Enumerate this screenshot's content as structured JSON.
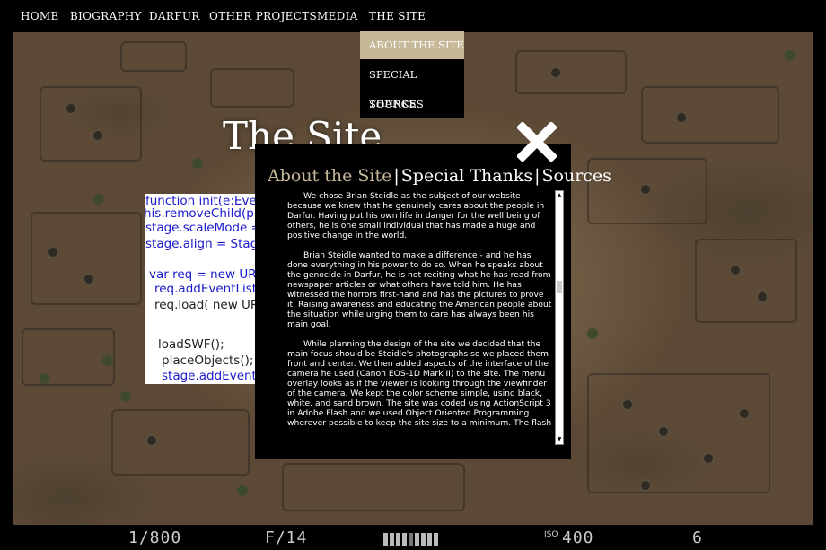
{
  "nav": {
    "items": [
      "HOME",
      "BIOGRAPHY",
      "DARFUR",
      "OTHER PROJECTS",
      "MEDIA",
      "THE SITE"
    ]
  },
  "dropdown": {
    "items": [
      "ABOUT THE SITE",
      "SPECIAL THANKS",
      "SOURCES"
    ],
    "active": "ABOUT THE SITE"
  },
  "page": {
    "title": "The Site",
    "tabs": {
      "about": "About the Site",
      "thanks": "Special Thanks",
      "sources": "Sources",
      "separator": "|"
    },
    "paragraphs": [
      "We chose Brian Steidle as the subject of our website because we knew that he genuinely cares about the people in Darfur. Having put his own life in danger for the well being of others, he is one small individual that has made a huge and positive change in the world.",
      "Brian Steidle wanted to make a difference - and he has done everything in his power to do so. When he speaks about the genocide in Darfur, he is not reciting what he has read from newspaper articles or what others have told him. He has witnessed the horrors first-hand and has the pictures to prove it. Raising awareness and educating the American people about the situation while urging them to care has always been his main goal.",
      "While planning the design of the site we decided that the main focus should be Steidle's photographs so we placed them front and center. We then added aspects of the interface of the camera he used (Canon EOS-1D Mark II) to the site. The menu overlay looks as if the viewer is looking through the viewfinder of the camera. We kept the color scheme simple, using black, white, and sand brown. The site was coded using ActionScript 3 in Adobe Flash and we used Object Oriented Programming wherever possible to keep the site size to a minimum. The flash"
    ]
  },
  "code_snippet": {
    "lines": [
      "function init(e:Event",
      "his.removeChild(preloa",
      "stage.scaleMode = Stag",
      "stage.align = StageAlig",
      "",
      "var req = new URLLoad",
      "req.addEventListener(",
      "req.load( new URLReq",
      "",
      "loadSWF();",
      "placeObjects();",
      "stage.addEventListe"
    ]
  },
  "camera": {
    "shutter": "1/800",
    "aperture": "F/14",
    "iso_label": "ISO",
    "iso": "400",
    "frames": "6",
    "meter_fraction": 0.5
  },
  "colors": {
    "accent": "#c8b89a",
    "code_blue": "#1a1acc",
    "code_dark": "#222222"
  }
}
